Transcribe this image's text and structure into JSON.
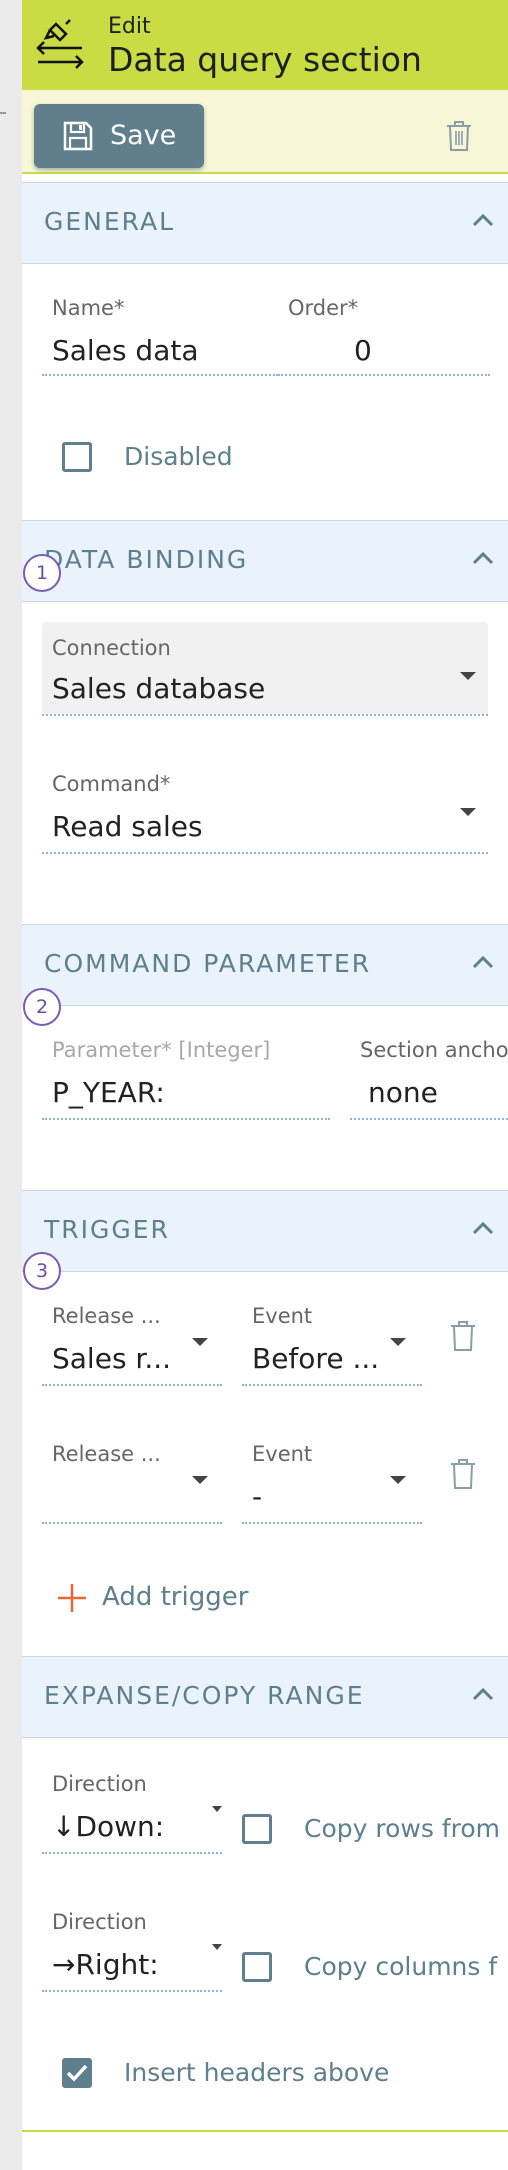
{
  "header": {
    "subtitle": "Edit",
    "title": "Data query section"
  },
  "toolbar": {
    "save_label": "Save"
  },
  "sections": {
    "general": {
      "title": "GENERAL",
      "name_label": "Name*",
      "name_value": "Sales data",
      "order_label": "Order*",
      "order_value": "0",
      "disabled_label": "Disabled"
    },
    "data_binding": {
      "title": "DATA BINDING",
      "badge": "1",
      "connection_label": "Connection",
      "connection_value": "Sales database",
      "command_label": "Command*",
      "command_value": "Read sales"
    },
    "command_parameter": {
      "title": "COMMAND PARAMETER",
      "badge": "2",
      "param_label": "Parameter* [Integer]",
      "param_value": "P_YEAR:",
      "anchor_label": "Section ancho",
      "anchor_value": "none"
    },
    "trigger": {
      "title": "TRIGGER",
      "badge": "3",
      "rows": [
        {
          "release_label": "Release ...",
          "release_value": "Sales r...",
          "event_label": "Event",
          "event_value": "Before ..."
        },
        {
          "release_label": "Release ...",
          "release_value": "",
          "event_label": "Event",
          "event_value": "-"
        }
      ],
      "add_label": "Add trigger"
    },
    "expanse": {
      "title": "EXPANSE/COPY RANGE",
      "direction_label_1": "Direction",
      "direction_value_1": "↓Down:",
      "copy_rows_label": "Copy rows from",
      "direction_label_2": "Direction",
      "direction_value_2": "→Right:",
      "copy_cols_label": "Copy columns f",
      "insert_headers_label": "Insert headers above",
      "insert_headers_checked": true
    }
  },
  "colors": {
    "accent": "#c9dc43",
    "button": "#5f7f8d",
    "section_bg": "#eaf3fb",
    "badge": "#7a5bb5",
    "add": "#e8653a"
  }
}
